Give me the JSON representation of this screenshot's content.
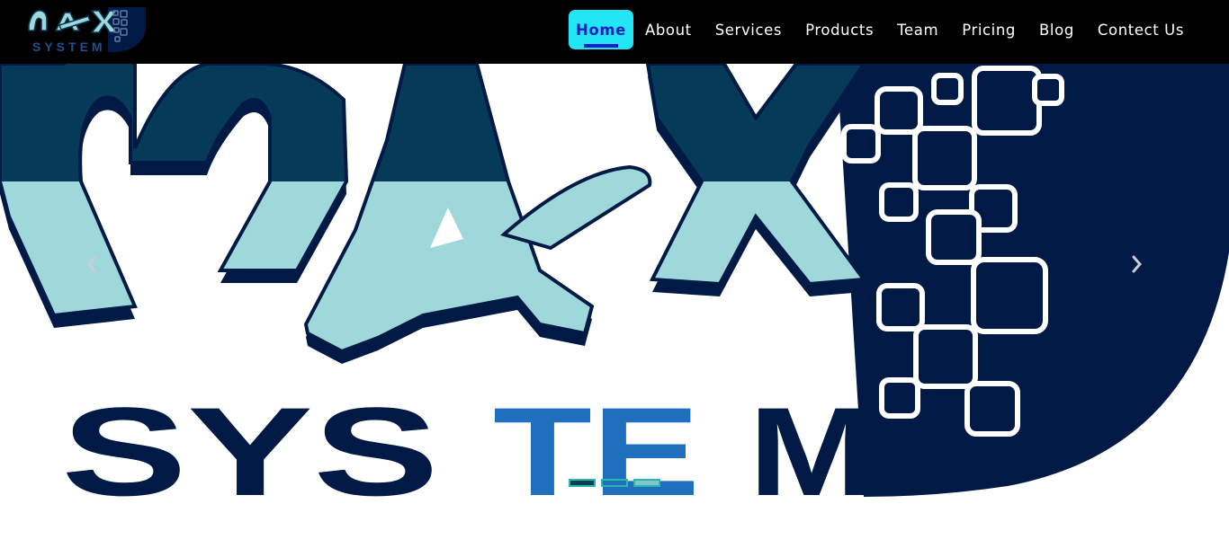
{
  "brand": {
    "name": "MAX SYSTEM",
    "logo_top": "MAX",
    "logo_bottom": "SYSTEM"
  },
  "nav": {
    "items": [
      {
        "label": "Home",
        "active": true
      },
      {
        "label": "About"
      },
      {
        "label": "Services"
      },
      {
        "label": "Products"
      },
      {
        "label": "Team"
      },
      {
        "label": "Pricing"
      },
      {
        "label": "Blog"
      },
      {
        "label": "Contect Us"
      }
    ]
  },
  "hero": {
    "logo_text": "SYSTEM",
    "prev_icon": "chevron-left-icon",
    "next_icon": "chevron-right-icon",
    "slides_count": 3,
    "active_slide": 1
  },
  "colors": {
    "navbar_bg": "#000000",
    "active_bg": "#22e6f5",
    "active_text": "#1c1cc8",
    "logo_dark": "#001a45",
    "logo_teal_dark": "#053a59",
    "logo_teal_light": "#9ed8da",
    "logo_blue": "#1f6fbf"
  }
}
